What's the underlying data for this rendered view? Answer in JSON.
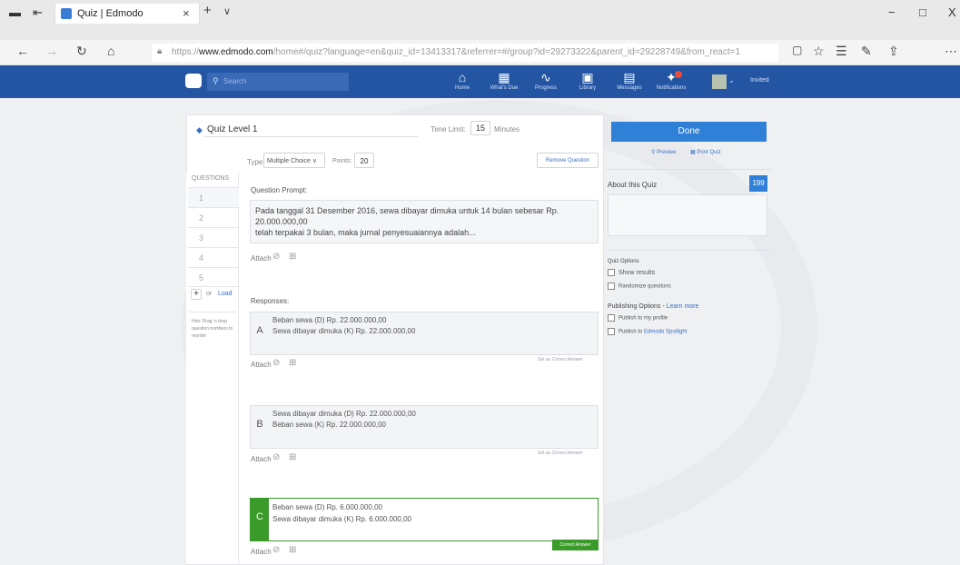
{
  "browser": {
    "tab_title": "Quiz | Edmodo",
    "new_tab": "+",
    "tab_menu": "∨",
    "url_prefix": "https://",
    "url_domain": "www.edmodo.com",
    "url_rest": "/home#/quiz?language=en&quiz_id=13413317&referrer=#/group?id=29273322&parent_id=29228749&from_react=1",
    "window_min": "−",
    "window_max": "□",
    "window_close": "X"
  },
  "topnav": {
    "search_placeholder": "Search",
    "items": [
      {
        "label": "Home",
        "icon": "home-icon"
      },
      {
        "label": "What's Due",
        "icon": "calendar-icon"
      },
      {
        "label": "Progress",
        "icon": "progress-icon"
      },
      {
        "label": "Library",
        "icon": "library-icon"
      },
      {
        "label": "Messages",
        "icon": "messages-icon"
      },
      {
        "label": "Notifications",
        "icon": "bell-icon"
      }
    ],
    "user": "Invited"
  },
  "quiz": {
    "title": "Quiz Level 1",
    "time_limit_label": "Time Limit:",
    "time_limit_value": "15",
    "time_limit_unit": "Minutes",
    "type_label": "Type:",
    "type_value": "Multiple Choice",
    "points_label": "Points:",
    "points_value": "20",
    "remove_question": "Remove Question",
    "questions_header": "QUESTIONS",
    "question_numbers": [
      "1",
      "2",
      "3",
      "4",
      "5"
    ],
    "add_or": "or",
    "load": "Load",
    "hint": "Hint: Drag 'n drop question numbers to reorder",
    "prompt_label": "Question Prompt:",
    "prompt_text_1": "Pada tanggal 31 Desember 2016, sewa dibayar dimuka untuk 14 bulan sebesar Rp. 20.000.000,00",
    "prompt_text_2": "telah terpakai 3 bulan, maka jurnal penyesuaiannya adalah...",
    "attach": "Attach",
    "responses_label": "Responses:",
    "responses": [
      {
        "letter": "A",
        "line1": "Beban sewa (D) Rp. 22.000.000,00",
        "line2": "Sewa dibayar dimuka (K) Rp. 22.000.000,00",
        "action": "Set as Correct Answer"
      },
      {
        "letter": "B",
        "line1": "Sewa dibayar dimuka (D) Rp. 22.000.000,00",
        "line2": "Beban sewa (K) Rp. 22.000.000,00",
        "action": "Set as Correct Answer"
      },
      {
        "letter": "C",
        "line1": "Beban sewa (D) Rp. 6.000.000,00",
        "line2": "Sewa dibayar dimuka (K) Rp. 6.000.000,00",
        "action": "Correct Answer"
      }
    ]
  },
  "sidebar": {
    "done": "Done",
    "preview": "Preview",
    "print_quiz": "Print Quiz",
    "about_label": "About this Quiz",
    "about_count": "199",
    "options_label": "Quiz Options",
    "show_results": "Show results",
    "randomize": "Randomize questions",
    "publishing_label": "Publishing Options -",
    "learn_more": "Learn more",
    "publish_profile": "Publish to my profile",
    "publish_prefix": "Publish to",
    "spotlight": "Edmodo Spotlight"
  },
  "colors": {
    "accent": "#2f80d6",
    "correct": "#3a9a2a"
  }
}
